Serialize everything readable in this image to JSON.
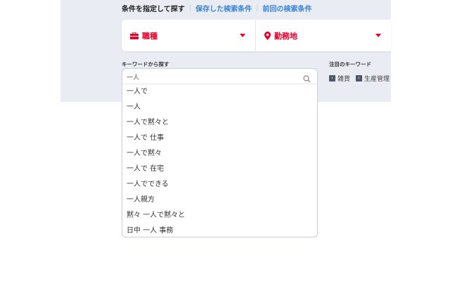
{
  "header": {
    "title": "条件を指定して探す",
    "saved_link": "保存した検索条件",
    "previous_link": "前回の検索条件"
  },
  "criteria": {
    "job_label": "職種",
    "location_label": "勤務地",
    "accent_color": "#e4002b",
    "job_icon": "briefcase-icon",
    "location_icon": "map-pin-icon"
  },
  "keyword_search": {
    "label": "キーワードから探す",
    "input_value": "一人",
    "suggestions": [
      "一人で",
      "一人",
      "一人で黙々と",
      "一人で 仕事",
      "一人で黙々",
      "一人で 在宅",
      "一人でできる",
      "一人親方",
      "黙々 一人で黙々と",
      "日中 一人 事務"
    ]
  },
  "hot_keywords": {
    "label": "注目のキーワード",
    "items": [
      "雑貨",
      "生産管理"
    ]
  }
}
